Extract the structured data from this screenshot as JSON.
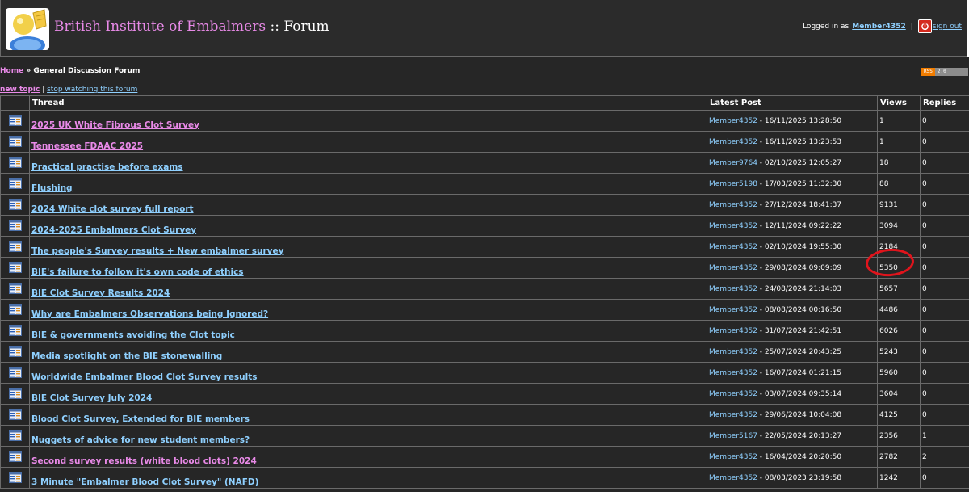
{
  "header": {
    "site_name": "British Institute of Embalmers",
    "title_separator": " :: ",
    "section_name": "Forum",
    "logged_in_prefix": "Logged in as",
    "username": "Member4352",
    "separator": "|",
    "sign_out_label": "sign out",
    "logo_icon": "user-avatar-icon",
    "sign_out_icon": "power-icon"
  },
  "breadcrumb": {
    "home_label": "Home",
    "divider": "»",
    "current": "General Discussion Forum"
  },
  "rss_badge": {
    "left": "RSS",
    "right": "2.0"
  },
  "forum_actions": {
    "new_topic_label": "new topic",
    "divider": "|",
    "stop_watching_label": "stop watching this forum"
  },
  "table": {
    "headers": {
      "thread": "Thread",
      "latest": "Latest Post",
      "views": "Views",
      "replies": "Replies"
    },
    "rows": [
      {
        "title": "2025 UK White Fibrous Clot Survey",
        "new": true,
        "author": "Member4352",
        "date": " - 16/11/2025 13:28:50",
        "views": "1",
        "replies": "0"
      },
      {
        "title": "Tennessee FDAAC 2025",
        "new": true,
        "author": "Member4352",
        "date": " - 16/11/2025 13:23:53",
        "views": "1",
        "replies": "0"
      },
      {
        "title": "Practical practise before exams",
        "new": false,
        "author": "Member9764",
        "date": " - 02/10/2025 12:05:27",
        "views": "18",
        "replies": "0"
      },
      {
        "title": "Flushing",
        "new": false,
        "author": "Member5198",
        "date": " - 17/03/2025 11:32:30",
        "views": "88",
        "replies": "0"
      },
      {
        "title": "2024 White clot survey full report",
        "new": false,
        "author": "Member4352",
        "date": " - 27/12/2024 18:41:37",
        "views": "9131",
        "replies": "0"
      },
      {
        "title": "2024-2025 Embalmers Clot Survey",
        "new": false,
        "author": "Member4352",
        "date": " - 12/11/2024 09:22:22",
        "views": "3094",
        "replies": "0"
      },
      {
        "title": "The people's Survey results + New embalmer survey",
        "new": false,
        "author": "Member4352",
        "date": " - 02/10/2024 19:55:30",
        "views": "2184",
        "replies": "0"
      },
      {
        "title": "BIE's failure to follow it's own code of ethics",
        "new": false,
        "author": "Member4352",
        "date": " - 29/08/2024 09:09:09",
        "views": "5350",
        "replies": "0"
      },
      {
        "title": "BIE Clot Survey Results 2024",
        "new": false,
        "author": "Member4352",
        "date": " - 24/08/2024 21:14:03",
        "views": "5657",
        "replies": "0"
      },
      {
        "title": "Why are Embalmers Observations being Ignored?",
        "new": false,
        "author": "Member4352",
        "date": " - 08/08/2024 00:16:50",
        "views": "4486",
        "replies": "0"
      },
      {
        "title": "BIE & governments avoiding the Clot topic",
        "new": false,
        "author": "Member4352",
        "date": " - 31/07/2024 21:42:51",
        "views": "6026",
        "replies": "0"
      },
      {
        "title": "Media spotlight on the BIE stonewalling",
        "new": false,
        "author": "Member4352",
        "date": " - 25/07/2024 20:43:25",
        "views": "5243",
        "replies": "0"
      },
      {
        "title": "Worldwide Embalmer Blood Clot Survey results",
        "new": false,
        "author": "Member4352",
        "date": " - 16/07/2024 01:21:15",
        "views": "5960",
        "replies": "0"
      },
      {
        "title": "BIE Clot Survey July 2024",
        "new": false,
        "author": "Member4352",
        "date": " - 03/07/2024 09:35:14",
        "views": "3604",
        "replies": "0"
      },
      {
        "title": "Blood Clot Survey, Extended for BIE members",
        "new": false,
        "author": "Member4352",
        "date": " - 29/06/2024 10:04:08",
        "views": "4125",
        "replies": "0"
      },
      {
        "title": "Nuggets of advice for new student members?",
        "new": false,
        "author": "Member5167",
        "date": " - 22/05/2024 20:13:27",
        "views": "2356",
        "replies": "1"
      },
      {
        "title": "Second survey results (white blood clots) 2024",
        "new": true,
        "author": "Member4352",
        "date": " - 16/04/2024 20:20:50",
        "views": "2782",
        "replies": "2"
      },
      {
        "title": "3 Minute \"Embalmer Blood Clot Survey\" (NAFD)",
        "new": false,
        "author": "Member4352",
        "date": " - 08/03/2023 23:19:58",
        "views": "1242",
        "replies": "0"
      }
    ]
  },
  "colors": {
    "background": "#262626",
    "border": "#6a6a6a",
    "link_new": "#e98ae8",
    "link_read": "#8fd0ff",
    "highlight": "#e0141c"
  },
  "row_icon": "thread-list-icon"
}
